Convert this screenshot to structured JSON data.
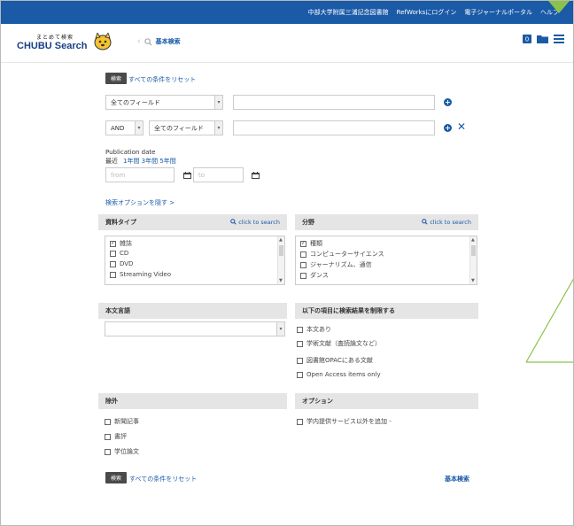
{
  "topbar": {
    "links": [
      "中部大学附属三浦記念図書館",
      "RefWorksにログイン",
      "電子ジャーナルポータル",
      "ヘルプ"
    ]
  },
  "header": {
    "logo_small": "まとめて検索",
    "logo_big": "CHUBU Search",
    "breadcrumb": "基本検索",
    "icons": [
      "mascot-icon",
      "chevron-left-icon",
      "search-icon",
      "notification-badge-icon",
      "folder-icon",
      "menu-icon"
    ]
  },
  "form": {
    "search_button": "検索",
    "reset_link": "すべての条件をリセット",
    "field1_select": "全てのフィールド",
    "field1_value": "",
    "bool_select": "AND",
    "field2_select": "全てのフィールド",
    "field2_value": "",
    "pubdate_label": "Publication date",
    "recent_prefix": "最近",
    "recent_links": "1年間 3年間 5年間",
    "from_placeholder": "from",
    "to_placeholder": "to",
    "hide_options_link": "検索オプションを隠す >"
  },
  "panels": {
    "material_type": {
      "title": "資料タイプ",
      "search_link": "click to search",
      "items": [
        {
          "label": "雑誌",
          "checked": true
        },
        {
          "label": "CD",
          "checked": false
        },
        {
          "label": "DVD",
          "checked": false
        },
        {
          "label": "Streaming Video",
          "checked": false
        }
      ]
    },
    "subject": {
      "title": "分野",
      "search_link": "click to search",
      "items": [
        {
          "label": "種類",
          "checked": true
        },
        {
          "label": "コンピューターサイエンス",
          "checked": false
        },
        {
          "label": "ジャーナリズム、通信",
          "checked": false
        },
        {
          "label": "ダンス",
          "checked": false
        }
      ]
    },
    "language": {
      "title": "本文言語",
      "selected": ""
    },
    "limit": {
      "title": "以下の項目に検索結果を制限する",
      "items": [
        "本文あり",
        "学術文献（査読論文など）",
        "図書館OPACにある文献",
        "Open Access items only"
      ]
    },
    "exclude": {
      "title": "除外",
      "items": [
        "新聞記事",
        "書評",
        "学位論文"
      ]
    },
    "options": {
      "title": "オプション",
      "items": [
        "学内提供サービス以外を追加 -"
      ]
    }
  },
  "footer": {
    "search_button": "検索",
    "reset_link": "すべての条件をリセット",
    "basic_link": "基本検索"
  },
  "colors": {
    "topbar": "#1a5aa6",
    "accent": "#1a5aa6",
    "panel_header": "#e5e5e5",
    "annotation": "#8bc34a"
  }
}
